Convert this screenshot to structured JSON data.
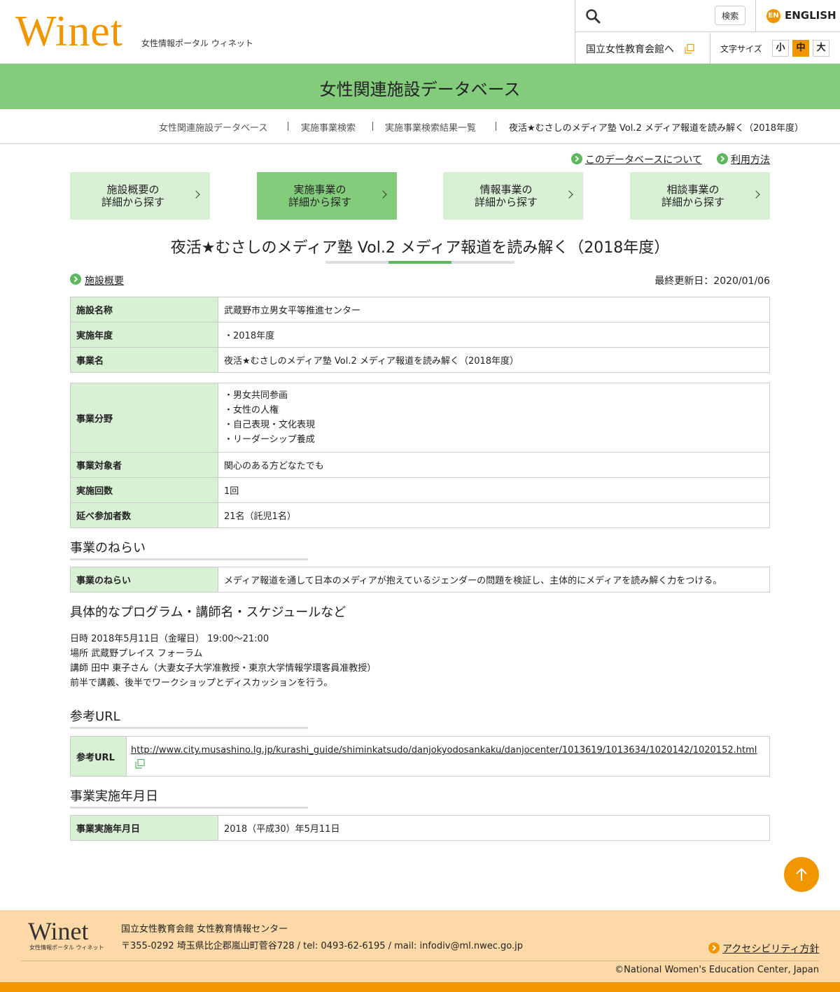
{
  "header": {
    "logo_word": "Winet",
    "logo_sub": "女性情報ポータル ウィネット",
    "search_placeholder": "",
    "search_button": "検索",
    "english_badge": "EN",
    "english_label": "ENGLISH",
    "nwec_link": "国立女性教育会館へ",
    "font_size_label": "文字サイズ",
    "font_sizes": [
      "小",
      "中",
      "大"
    ],
    "font_size_active": "中"
  },
  "band_title": "女性関連施設データベース",
  "breadcrumb": [
    "女性関連施設データベース",
    "実施事業検索",
    "実施事業検索結果一覧",
    "夜活★むさしのメディア塾 Vol.2 メディア報道を読み解く（2018年度）"
  ],
  "top_links": [
    "このデータベースについて",
    "利用方法"
  ],
  "nav_tabs": [
    {
      "line1": "施設概要の",
      "line2": "詳細から探す"
    },
    {
      "line1": "実施事業の",
      "line2": "詳細から探す"
    },
    {
      "line1": "情報事業の",
      "line2": "詳細から探す"
    },
    {
      "line1": "相談事業の",
      "line2": "詳細から探す"
    }
  ],
  "page_title": "夜活★むさしのメディア塾 Vol.2 メディア報道を読み解く（2018年度）",
  "overview_link": "施設概要",
  "last_updated": "最終更新日：2020/01/06",
  "table1": [
    {
      "label": "施設名称",
      "value": "武蔵野市立男女平等推進センター"
    },
    {
      "label": "実施年度",
      "value": "・2018年度"
    },
    {
      "label": "事業名",
      "value": "夜活★むさしのメディア塾 Vol.2 メディア報道を読み解く（2018年度）"
    }
  ],
  "table2": {
    "field_label": "事業分野",
    "field_values": [
      "・男女共同参画",
      "・女性の人権",
      "・自己表現・文化表現",
      "・リーダーシップ養成"
    ],
    "rows": [
      {
        "label": "事業対象者",
        "value": "関心のある方どなたでも"
      },
      {
        "label": "実施回数",
        "value": "1回"
      },
      {
        "label": "延べ参加者数",
        "value": "21名（託児1名）"
      }
    ]
  },
  "aim": {
    "heading": "事業のねらい",
    "label": "事業のねらい",
    "value": "メディア報道を通して日本のメディアが抱えているジェンダーの問題を検証し、主体的にメディアを読み解く力をつける。"
  },
  "program": {
    "heading": "具体的なプログラム・講師名・スケジュールなど",
    "lines": [
      "日時 2018年5月11日（金曜日） 19:00～21:00",
      "場所 武蔵野プレイス フォーラム",
      "講師 田中 東子さん（大妻女子大学准教授・東京大学情報学環客員准教授）",
      "前半で講義、後半でワークショップとディスカッションを行う。"
    ]
  },
  "ref_url": {
    "heading": "参考URL",
    "label": "参考URL",
    "value": "http://www.city.musashino.lg.jp/kurashi_guide/shiminkatsudo/danjokyodosankaku/danjocenter/1013619/1013634/1020142/1020152.html"
  },
  "date": {
    "heading": "事業実施年月日",
    "label": "事業実施年月日",
    "value": "2018（平成30）年5月11日"
  },
  "footer": {
    "logo_word": "Winet",
    "logo_sub": "女性情報ポータル ウィネット",
    "org": "国立女性教育会館 女性教育情報センター",
    "address": "〒355-0292 埼玉県比企郡嵐山町菅谷728 / tel: 0493-62-6195 / mail: infodiv@ml.nwec.go.jp",
    "accessibility": "アクセシビリティ方針",
    "copyright": "©National Women's Education Center, Japan"
  },
  "colors": {
    "accent_orange": "#f29600",
    "band_green": "#83cc7c",
    "light_green": "#d8f0d4",
    "footer_bg": "#fcd9a6"
  }
}
